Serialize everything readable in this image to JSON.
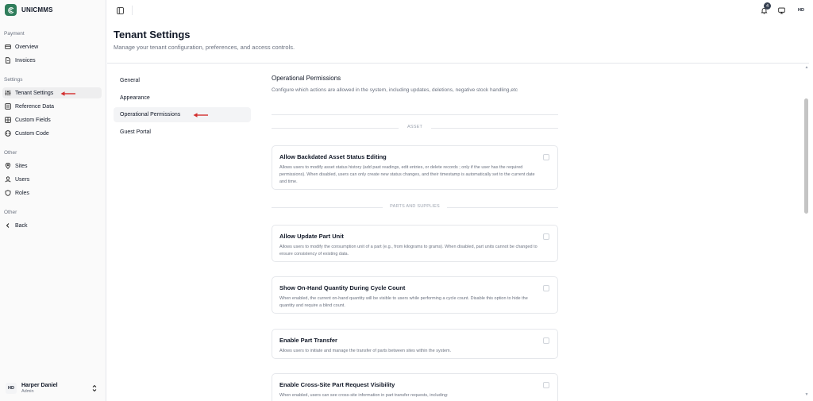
{
  "brand": {
    "name": "UNICMMS",
    "icon": "brand-logo-icon",
    "color": "#2f7d5b"
  },
  "sidebar": {
    "groups": [
      {
        "label": "Payment",
        "items": [
          {
            "label": "Overview",
            "icon": "wallet-icon"
          },
          {
            "label": "Invoices",
            "icon": "file-icon"
          }
        ]
      },
      {
        "label": "Settings",
        "items": [
          {
            "label": "Tenant Settings",
            "icon": "sliders-icon",
            "active": true
          },
          {
            "label": "Reference Data",
            "icon": "list-icon"
          },
          {
            "label": "Custom Fields",
            "icon": "grid-icon"
          },
          {
            "label": "Custom Code",
            "icon": "code-icon"
          }
        ]
      },
      {
        "label": "Other",
        "items": [
          {
            "label": "Sites",
            "icon": "map-pin-icon"
          },
          {
            "label": "Users",
            "icon": "user-icon"
          },
          {
            "label": "Roles",
            "icon": "shield-icon"
          }
        ]
      },
      {
        "label": "Other",
        "items": [
          {
            "label": "Back",
            "icon": "chevron-left-icon"
          }
        ]
      }
    ],
    "user": {
      "initials": "HD",
      "name": "Harper Daniel",
      "role": "Admin"
    }
  },
  "topbar": {
    "notifications_count": "4",
    "avatar_initials": "HD"
  },
  "header": {
    "title": "Tenant Settings",
    "subtitle": "Manage your tenant configuration, preferences, and access controls."
  },
  "settings_nav": {
    "items": [
      {
        "label": "General"
      },
      {
        "label": "Appearance"
      },
      {
        "label": "Operational Permissions",
        "active": true
      },
      {
        "label": "Guest Portal"
      }
    ]
  },
  "content": {
    "title": "Operational Permissions",
    "description": "Configure which actions are allowed in the system, including updates, deletions, negative stock handling,etc",
    "groups": [
      {
        "label": "ASSET"
      },
      {
        "label": "PARTS AND SUPPLIES"
      }
    ],
    "cards": [
      {
        "title": "Allow Backdated Asset Status Editing",
        "description": "Allows users to modify asset status history (add past readings, edit entries, or delete records ; only if the user has the required permissions). When disabled, users can only create new status changes, and their timestamp is automatically set to the current date and time.",
        "checked": false
      },
      {
        "title": "Allow Update Part Unit",
        "description": "Allows users to modify the consumption unit of a part (e.g., from kilograms to grams). When disabled, part units cannot be changed to ensure consistency of existing data.",
        "checked": false
      },
      {
        "title": "Show On-Hand Quantity During Cycle Count",
        "description": "When enabled, the current on-hand quantity will be visible to users while performing a cycle count. Disable this option to hide the quantity and require a blind count.",
        "checked": false
      },
      {
        "title": "Enable Part Transfer",
        "description": "Allows users to initiate and manage the transfer of parts between sites within the system.",
        "checked": false
      },
      {
        "title": "Enable Cross-Site Part Request Visibility",
        "description": "When enabled, users can see cross-site information in part transfer requests, including:",
        "checked": false
      }
    ]
  },
  "colors": {
    "accent": "#2f7d5b",
    "annotation_arrow": "#d32f2f",
    "active_bg": "#eeeeef"
  }
}
